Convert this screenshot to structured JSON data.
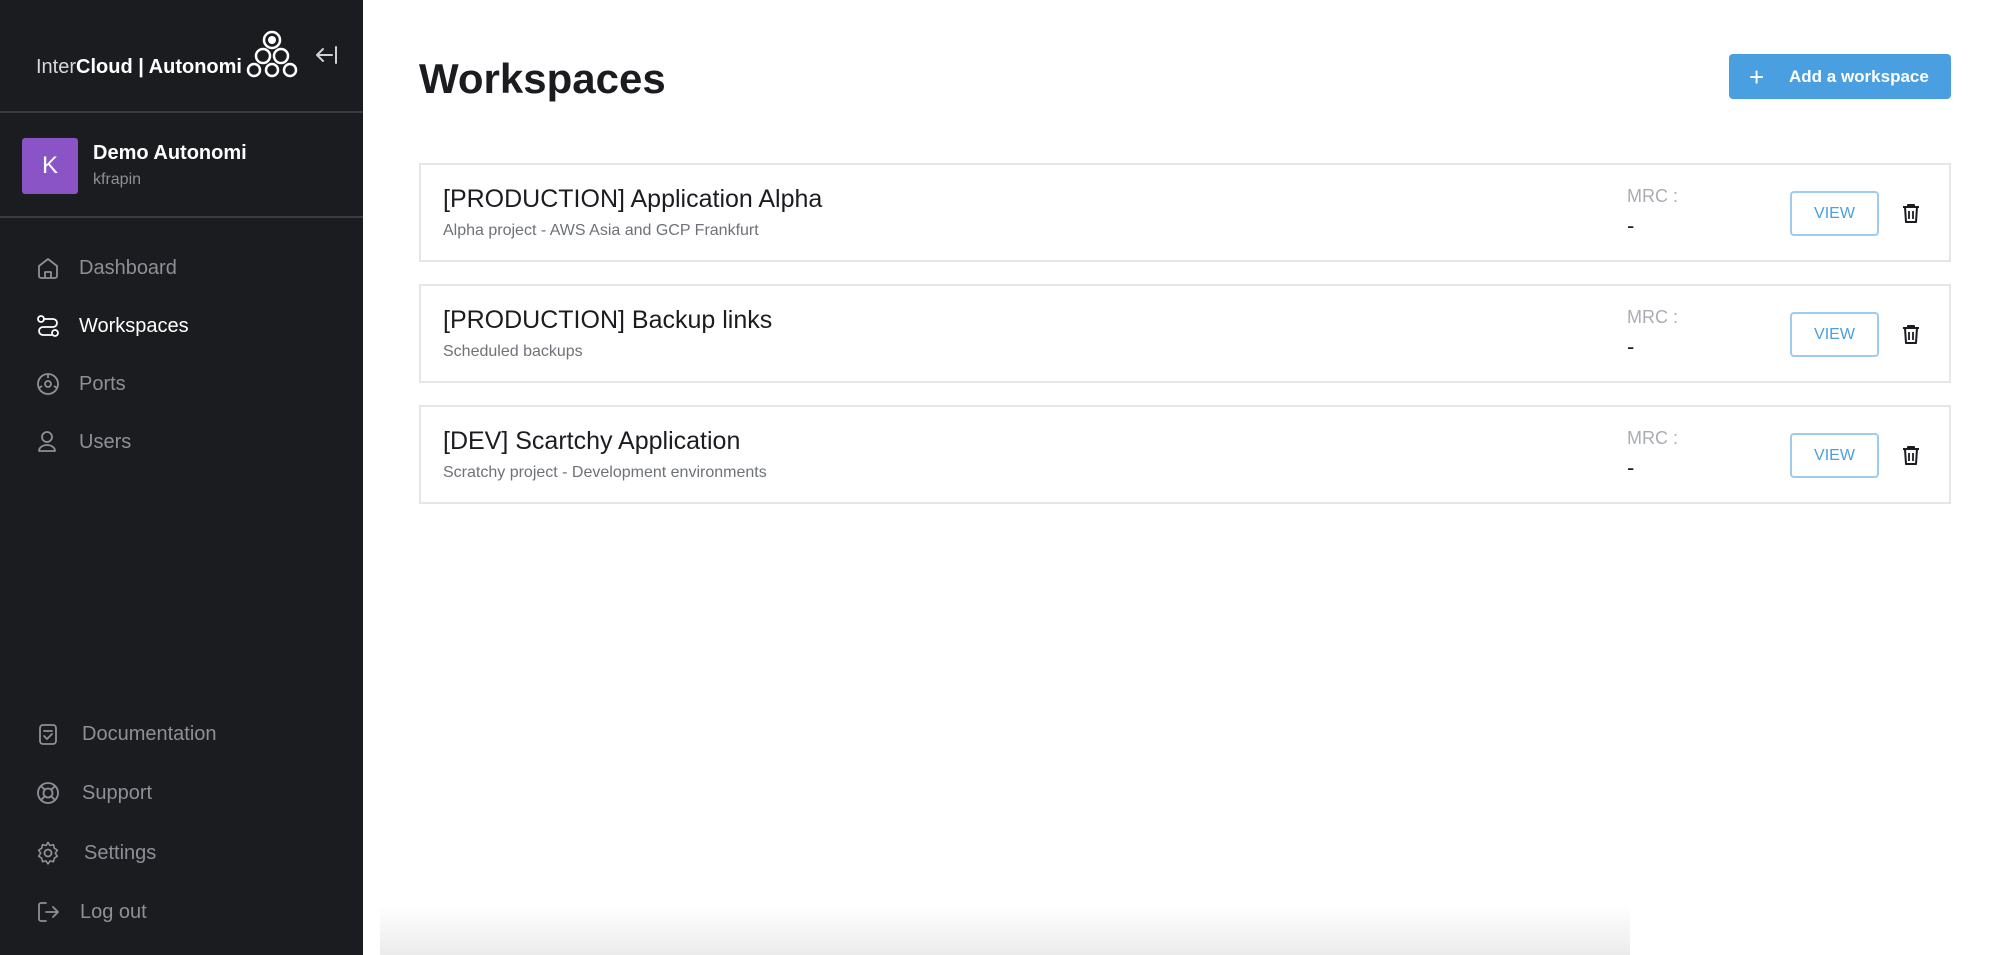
{
  "brand": {
    "prefix": "Inter",
    "bold": "Cloud",
    "suffix": " | Autonomi"
  },
  "account": {
    "initial": "K",
    "name": "Demo Autonomi",
    "username": "kfrapin"
  },
  "nav": [
    {
      "label": "Dashboard",
      "icon": "home-icon",
      "active": false
    },
    {
      "label": "Workspaces",
      "icon": "workflow-icon",
      "active": true
    },
    {
      "label": "Ports",
      "icon": "ports-icon",
      "active": false
    },
    {
      "label": "Users",
      "icon": "users-icon",
      "active": false
    }
  ],
  "footer_nav": [
    {
      "label": "Documentation",
      "icon": "documentation-icon"
    },
    {
      "label": "Support",
      "icon": "support-lifebuoy-icon"
    },
    {
      "label": "Settings",
      "icon": "gear-icon"
    },
    {
      "label": "Log out",
      "icon": "logout-icon"
    }
  ],
  "page": {
    "title": "Workspaces",
    "add_label": "Add a workspace",
    "add_icon": "+"
  },
  "workspaces": [
    {
      "title": "[PRODUCTION] Application Alpha",
      "description": "Alpha project - AWS Asia and GCP Frankfurt",
      "mrc_label": "MRC :",
      "mrc_value": "-",
      "view_label": "VIEW"
    },
    {
      "title": "[PRODUCTION] Backup links",
      "description": "Scheduled backups",
      "mrc_label": "MRC :",
      "mrc_value": "-",
      "view_label": "VIEW"
    },
    {
      "title": "[DEV] Scartchy Application",
      "description": "Scratchy project - Development environments",
      "mrc_label": "MRC :",
      "mrc_value": "-",
      "view_label": "VIEW"
    }
  ],
  "colors": {
    "sidebar_bg": "#1b1c20",
    "accent": "#4a9fe0",
    "avatar": "#8a54c6"
  }
}
